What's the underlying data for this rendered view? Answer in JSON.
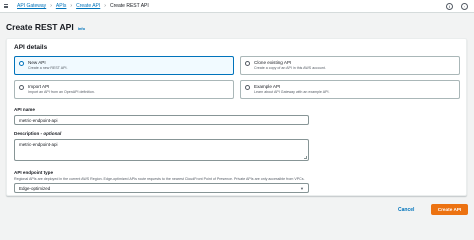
{
  "breadcrumb": {
    "items": [
      "API Gateway",
      "APIs",
      "Create API"
    ],
    "current": "Create REST API"
  },
  "header": {
    "title": "Create REST API",
    "info": "Info"
  },
  "api_details": {
    "title": "API details",
    "options": [
      {
        "label": "New API",
        "desc": "Create a new REST API.",
        "selected": true
      },
      {
        "label": "Clone existing API",
        "desc": "Create a copy of an API in this AWS account.",
        "selected": false
      },
      {
        "label": "Import API",
        "desc": "Import an API from an OpenAPI definition.",
        "selected": false
      },
      {
        "label": "Example API",
        "desc": "Learn about API Gateway with an example API.",
        "selected": false
      }
    ]
  },
  "form": {
    "name_label": "API name",
    "name_value": "metric-endpoint-api",
    "desc_label": "Description",
    "desc_optional": " - optional",
    "desc_value": "metric-endpoint-api",
    "type_label": "API endpoint type",
    "type_helper": "Regional APIs are deployed in the current AWS Region. Edge-optimized APIs route requests to the nearest CloudFront Point of Presence. Private APIs are only accessible from VPCs.",
    "type_value": "Edge-optimized"
  },
  "actions": {
    "cancel": "Cancel",
    "create": "Create API"
  },
  "colors": {
    "accent": "#0073bb",
    "primary_button": "#ec7211"
  }
}
